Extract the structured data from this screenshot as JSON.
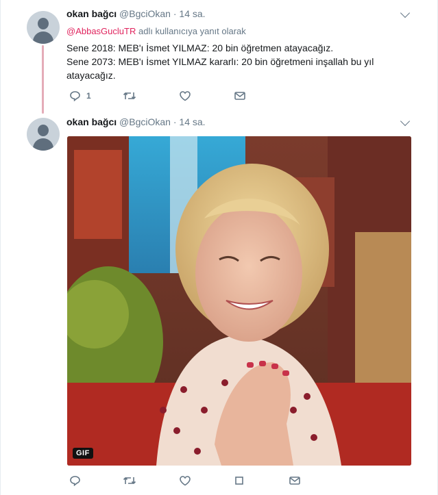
{
  "tweets": [
    {
      "name": "okan bağcı",
      "handle": "@BgciOkan",
      "separator": "·",
      "time": "14 sa.",
      "reply_mention": "@AbbasGucluTR",
      "reply_suffix": "adlı kullanıcıya yanıt olarak",
      "text_lines": [
        "Sene 2018: MEB'ı İsmet YILMAZ: 20 bin öğretmen atayacağız.",
        "Sene 2073: MEB'ı İsmet YILMAZ kararlı: 20 bin öğretmeni inşallah bu yıl",
        "atayacağız."
      ],
      "reply_count": "1"
    },
    {
      "name": "okan bağcı",
      "handle": "@BgciOkan",
      "separator": "·",
      "time": "14 sa.",
      "media_badge": "GIF"
    }
  ],
  "colors": {
    "accent_mention": "#e0245e",
    "thread_line": "#e4acb8",
    "secondary_text": "#657786"
  },
  "icons": [
    "user-avatar",
    "chevron-down-icon",
    "reply-icon",
    "retweet-icon",
    "like-icon",
    "message-icon",
    "stop-icon"
  ]
}
